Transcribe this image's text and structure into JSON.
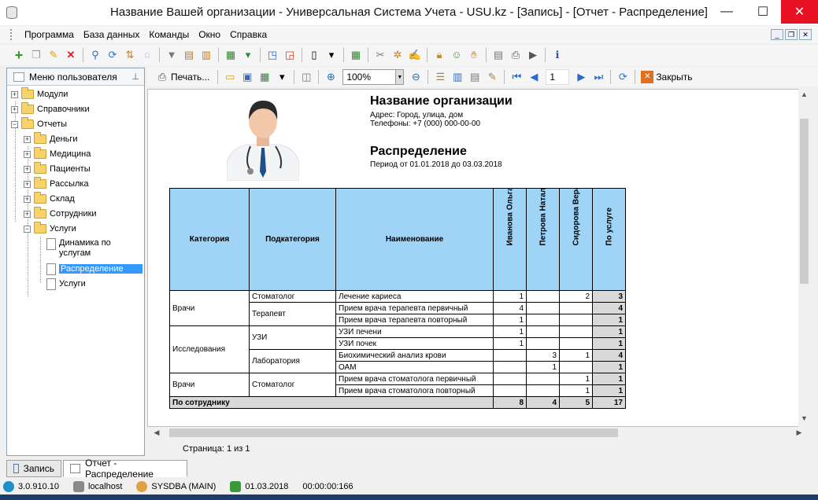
{
  "window": {
    "title": "Название Вашей организации - Универсальная Система Учета - USU.kz - [Запись] - [Отчет - Распределение]",
    "minimize": "—",
    "maximize": "☐",
    "close": "✕"
  },
  "menu": [
    "Программа",
    "База данных",
    "Команды",
    "Окно",
    "Справка"
  ],
  "sidebar": {
    "header": "Меню пользователя",
    "items": [
      {
        "label": "Модули",
        "expander": "+"
      },
      {
        "label": "Справочники",
        "expander": "+"
      },
      {
        "label": "Отчеты",
        "expander": "−"
      },
      {
        "label": "Деньги",
        "expander": "+"
      },
      {
        "label": "Медицина",
        "expander": "+"
      },
      {
        "label": "Пациенты",
        "expander": "+"
      },
      {
        "label": "Рассылка",
        "expander": "+"
      },
      {
        "label": "Склад",
        "expander": "+"
      },
      {
        "label": "Сотрудники",
        "expander": "+"
      },
      {
        "label": "Услуги",
        "expander": "−"
      },
      {
        "label": "Динамика по услугам"
      },
      {
        "label": "Распределение"
      },
      {
        "label": "Услуги"
      }
    ]
  },
  "report_toolbar": {
    "print_label": "Печать...",
    "zoom": "100%",
    "page": "1",
    "close_label": "Закрыть"
  },
  "report": {
    "org_name": "Название организации",
    "address": "Адрес: Город, улица, дом",
    "phones": "Телефоны: +7 (000) 000-00-00",
    "name": "Распределение",
    "period": "Период от 01.01.2018 до 03.03.2018",
    "columns": [
      "Категория",
      "Подкатегория",
      "Наименование",
      "Иванова Ольга",
      "Петрова Наталья",
      "Сидорова Вера",
      "По услуге"
    ],
    "rows": [
      {
        "category": "Врачи",
        "subcategory": "Стоматолог",
        "name": "Лечение кариеса",
        "v1": "1",
        "v2": "",
        "v3": "2",
        "total": "3"
      },
      {
        "category": "",
        "subcategory": "Терапевт",
        "name": "Прием врача терапевта первичный",
        "v1": "4",
        "v2": "",
        "v3": "",
        "total": "4"
      },
      {
        "category": "",
        "subcategory": "",
        "name": "Прием врача терапевта повторный",
        "v1": "1",
        "v2": "",
        "v3": "",
        "total": "1"
      },
      {
        "category": "Исследования",
        "subcategory": "УЗИ",
        "name": "УЗИ печени",
        "v1": "1",
        "v2": "",
        "v3": "",
        "total": "1"
      },
      {
        "category": "",
        "subcategory": "",
        "name": "УЗИ почек",
        "v1": "1",
        "v2": "",
        "v3": "",
        "total": "1"
      },
      {
        "category": "",
        "subcategory": "Лаборатория",
        "name": "Биохимический анализ крови",
        "v1": "",
        "v2": "3",
        "v3": "1",
        "total": "4"
      },
      {
        "category": "",
        "subcategory": "",
        "name": "ОАМ",
        "v1": "",
        "v2": "1",
        "v3": "",
        "total": "1"
      },
      {
        "category": "Врачи",
        "subcategory": "Стоматолог",
        "name": "Прием врача стоматолога первичный",
        "v1": "",
        "v2": "",
        "v3": "1",
        "total": "1"
      },
      {
        "category": "",
        "subcategory": "",
        "name": "Прием врача стоматолога повторный",
        "v1": "",
        "v2": "",
        "v3": "1",
        "total": "1"
      }
    ],
    "totals": {
      "label": "По сотруднику",
      "v1": "8",
      "v2": "4",
      "v3": "5",
      "total": "17"
    }
  },
  "pagebar": {
    "text": "Страница: 1 из 1"
  },
  "tabs": [
    "Запись",
    "Отчет - Распределение"
  ],
  "status": {
    "version": "3.0.910.10",
    "host": "localhost",
    "user": "SYSDBA (MAIN)",
    "date": "01.03.2018",
    "timer": "00:00:00:166"
  },
  "colors": {
    "header_fill": "#9fd4f7",
    "total_fill": "#d9d9d9",
    "selection": "#3399ff",
    "close_button": "#e81123"
  }
}
